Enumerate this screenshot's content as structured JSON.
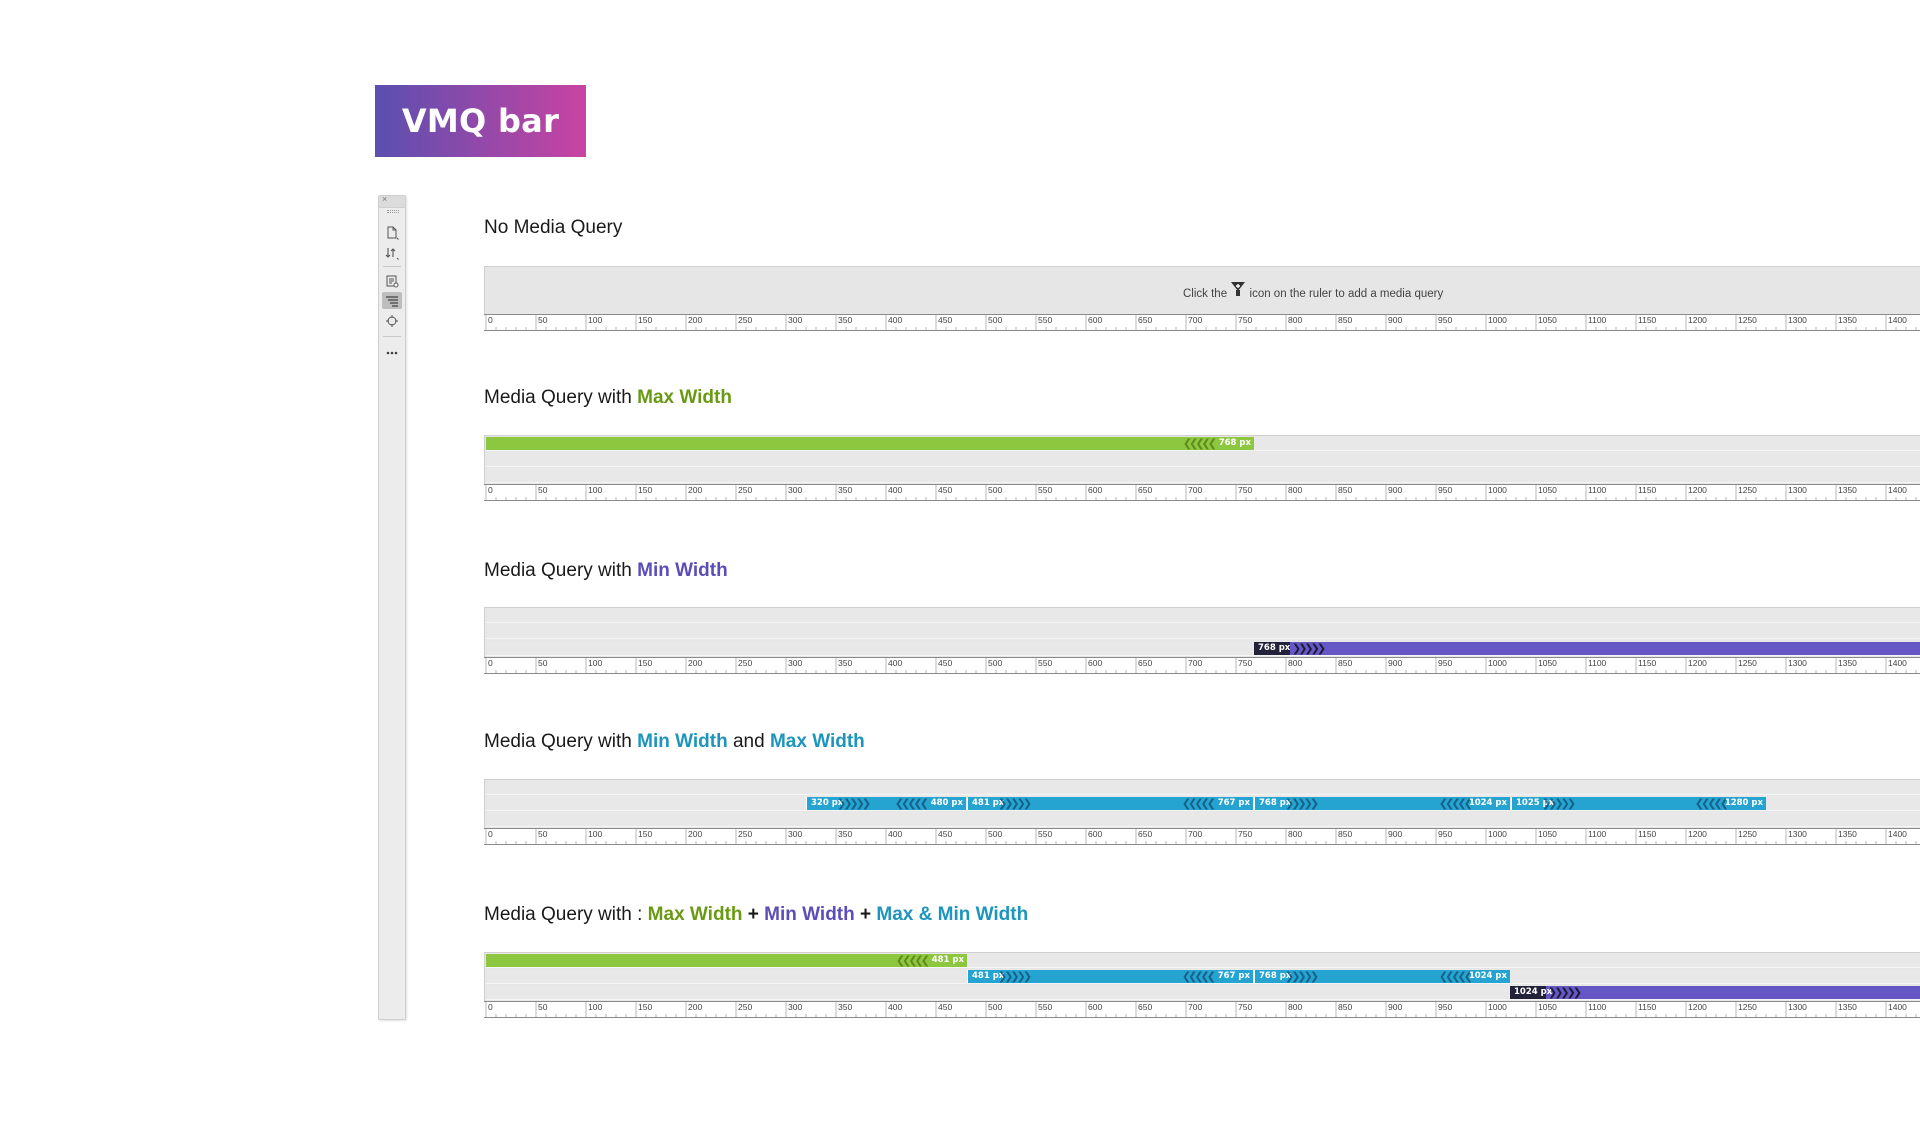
{
  "banner": {
    "title": "VMQ bar"
  },
  "colors": {
    "max": "#8dc63f",
    "min": "#6558c4",
    "range": "#25a4d1",
    "maxText": "#6a9a14",
    "minText": "#5b4eb8",
    "rangeText": "#1d95bd",
    "handleDark": "#22223a"
  },
  "toolbar": {
    "close_icon": "close-icon",
    "items": [
      {
        "icon": "new-document-icon"
      },
      {
        "icon": "sort-icon"
      },
      {
        "icon": "inspect-icon"
      },
      {
        "icon": "visual-media-queries-icon",
        "active": true
      },
      {
        "icon": "target-icon"
      },
      {
        "icon": "more-icon"
      }
    ]
  },
  "ruler_ticks": [
    "0",
    "50",
    "100",
    "150",
    "200",
    "250",
    "300",
    "350",
    "400",
    "450",
    "500",
    "550",
    "600",
    "650",
    "700",
    "750",
    "800",
    "850",
    "900",
    "950",
    "1000",
    "1050",
    "1100",
    "1150",
    "1200",
    "1250",
    "1300",
    "1350",
    "1400"
  ],
  "sections": {
    "none": {
      "title": "No Media Query",
      "hint_before": "Click the",
      "hint_after": "icon on the ruler to add a media query"
    },
    "max": {
      "title_prefix": "Media Query with ",
      "title_highlight": "Max Width",
      "bars": [
        {
          "type": "max",
          "to": 768,
          "label": "768",
          "unit": "px"
        }
      ]
    },
    "min": {
      "title_prefix": "Media Query with ",
      "title_highlight": "Min Width",
      "bars": [
        {
          "type": "min",
          "from": 768,
          "label": "768",
          "unit": "px"
        }
      ]
    },
    "range": {
      "title_prefix": "Media Query with ",
      "title_h1": "Min Width",
      "title_mid": " and ",
      "title_h2": "Max Width",
      "bars": [
        {
          "from": 320,
          "to": 480,
          "from_label": "320",
          "to_label": "480",
          "unit": "px"
        },
        {
          "from": 481,
          "to": 767,
          "from_label": "481",
          "to_label": "767",
          "unit": "px"
        },
        {
          "from": 768,
          "to": 1024,
          "from_label": "768",
          "to_label": "1024",
          "unit": "px"
        },
        {
          "from": 1025,
          "to": 1280,
          "from_label": "1025",
          "to_label": "1280",
          "unit": "px"
        }
      ]
    },
    "mixed": {
      "title_prefix": "Media Query with : ",
      "title_h1": "Max Width",
      "plus1": " + ",
      "title_h2": "Min Width",
      "plus2": " + ",
      "title_h3": "Max & Min Width",
      "max_bar": {
        "to": 481,
        "label": "481",
        "unit": "px"
      },
      "range_bars": [
        {
          "from": 481,
          "to": 767,
          "from_label": "481",
          "to_label": "767",
          "unit": "px"
        },
        {
          "from": 768,
          "to": 1024,
          "from_label": "768",
          "to_label": "1024",
          "unit": "px"
        }
      ],
      "min_bar": {
        "from": 1024,
        "label": "1024",
        "unit": "px"
      }
    }
  }
}
